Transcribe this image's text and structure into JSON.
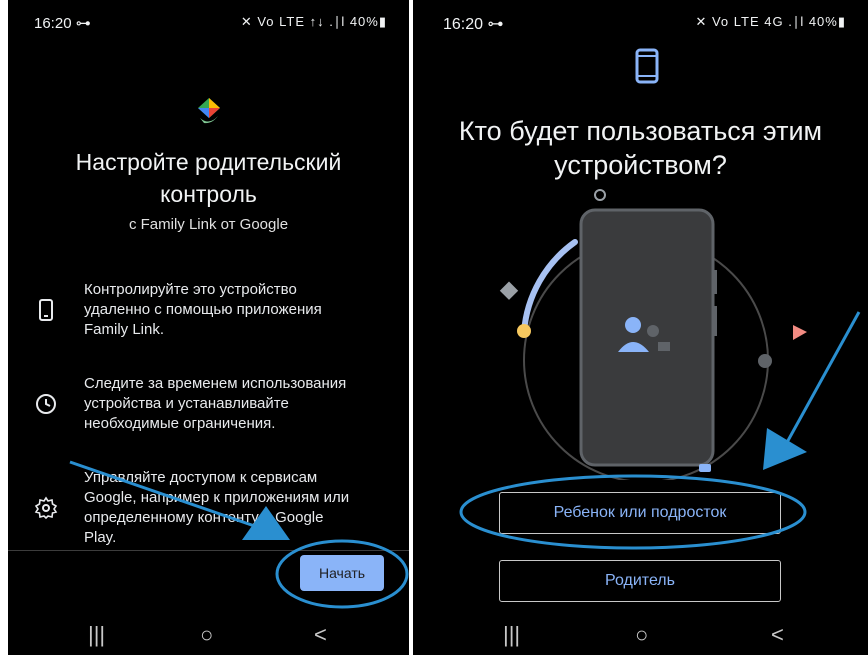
{
  "left_screen": {
    "status": {
      "time": "16:20 ⊶",
      "icons": "✕ Vo LTE ↑↓ .∣l 40%▮",
      "battery": "40%"
    },
    "logo_icon": "family-link-logo",
    "title_line1": "Настройте родительский",
    "title_line2": "контроль",
    "subtitle": "с Family Link от Google",
    "features": [
      {
        "icon": "phone-icon",
        "line1": "Контролируйте это устройство",
        "line2": "удаленно с помощью приложения",
        "line3": "Family Link."
      },
      {
        "icon": "clock-icon",
        "line1": "Следите за временем использования",
        "line2": "устройства и устанавливайте",
        "line3": "необходимые ограничения."
      },
      {
        "icon": "gear-icon",
        "line1": "Управляйте доступом к сервисам",
        "line2": "Google, например к приложениям или",
        "line3": "определенному контенту в Google",
        "line4": "Play."
      }
    ],
    "start_button": "Начать",
    "nav": {
      "recents": "|||",
      "home": "○",
      "back": "<"
    }
  },
  "right_screen": {
    "status": {
      "time": "16:20 ⊶",
      "icons": "✕ Vo LTE 4G .∣l 40%▮",
      "battery": "40%"
    },
    "top_icon": "phone-outline-icon",
    "title_line1": "Кто будет пользоваться этим",
    "title_line2": "устройством?",
    "option_child": "Ребенок или подросток",
    "option_parent": "Родитель",
    "nav": {
      "recents": "|||",
      "home": "○",
      "back": "<"
    }
  },
  "colors": {
    "accent": "#8ab4f8",
    "annotation": "#2a8fd0",
    "background": "#000000",
    "phone_body": "#3a3b3d"
  }
}
